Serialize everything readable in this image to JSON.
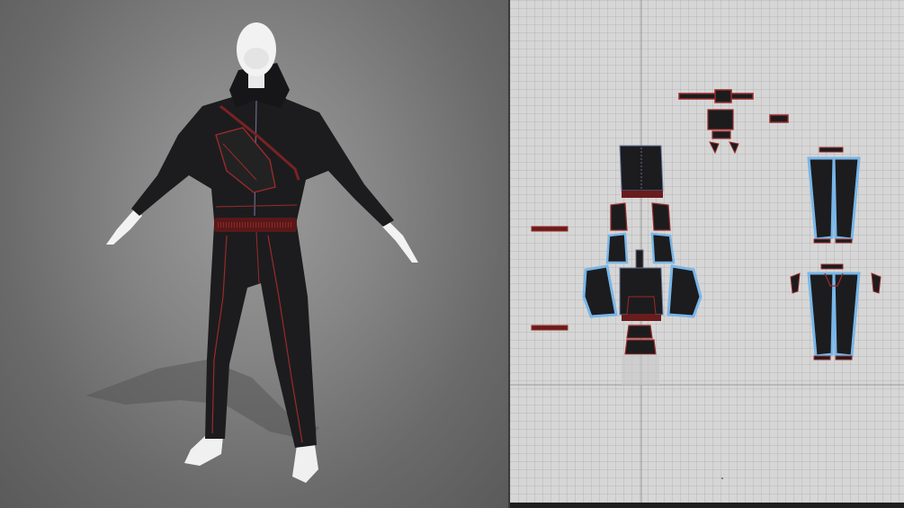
{
  "app": {
    "window_title": ""
  },
  "viewports": {
    "avatar_3d": {
      "label": ""
    },
    "pattern_2d": {
      "label": ""
    }
  },
  "colors": {
    "fabric": "#1c1c1e",
    "topstitch": "#9b2a2a",
    "trim": "#7a2222",
    "outline_selected": "#79b6e8",
    "avatar_skin": "#f2f2f2",
    "grid_bg": "#d6d6d6",
    "viewport_bg": "#858585"
  },
  "icons": {
    "avatar": "avatar-figure-icon",
    "grid": "pattern-grid-icon"
  }
}
